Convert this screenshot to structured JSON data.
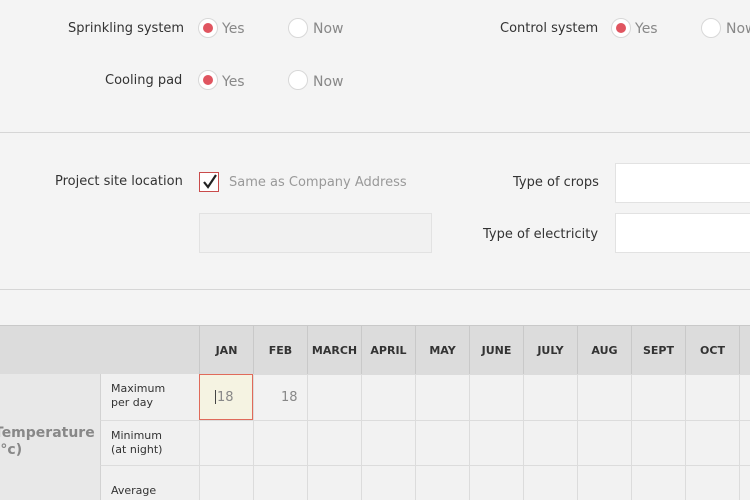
{
  "systems": {
    "sprinkling": {
      "label": "Sprinkling system",
      "yes": "Yes",
      "no": "Now",
      "selected": "yes"
    },
    "control": {
      "label": "Control system",
      "yes": "Yes",
      "no": "Now",
      "selected": "yes"
    },
    "cooling": {
      "label": "Cooling pad",
      "yes": "Yes",
      "no": "Now",
      "selected": "yes"
    }
  },
  "site": {
    "location_label": "Project site location",
    "same_as_company": "Same as Company Address",
    "same_checked": true,
    "crops_label": "Type of crops",
    "electricity_label": "Type of electricity",
    "location_value": "",
    "crops_value": "",
    "electricity_value": ""
  },
  "table": {
    "months": [
      "JAN",
      "FEB",
      "MARCH",
      "APRIL",
      "MAY",
      "JUNE",
      "JULY",
      "AUG",
      "SEPT",
      "OCT"
    ],
    "group_label_line1": "Temperature",
    "group_label_line2": "(°c)",
    "rows": [
      {
        "label_line1": "Maximum",
        "label_line2": "per day",
        "values": [
          "18",
          "18",
          "",
          "",
          "",
          "",
          "",
          "",
          "",
          ""
        ]
      },
      {
        "label_line1": "Minimum",
        "label_line2": "(at night)",
        "values": [
          "",
          "",
          "",
          "",
          "",
          "",
          "",
          "",
          "",
          ""
        ]
      },
      {
        "label_line1": "Average",
        "label_line2": "",
        "values": [
          "",
          "",
          "",
          "",
          "",
          "",
          "",
          "",
          "",
          ""
        ]
      }
    ]
  },
  "colors": {
    "accent": "#e05560"
  }
}
